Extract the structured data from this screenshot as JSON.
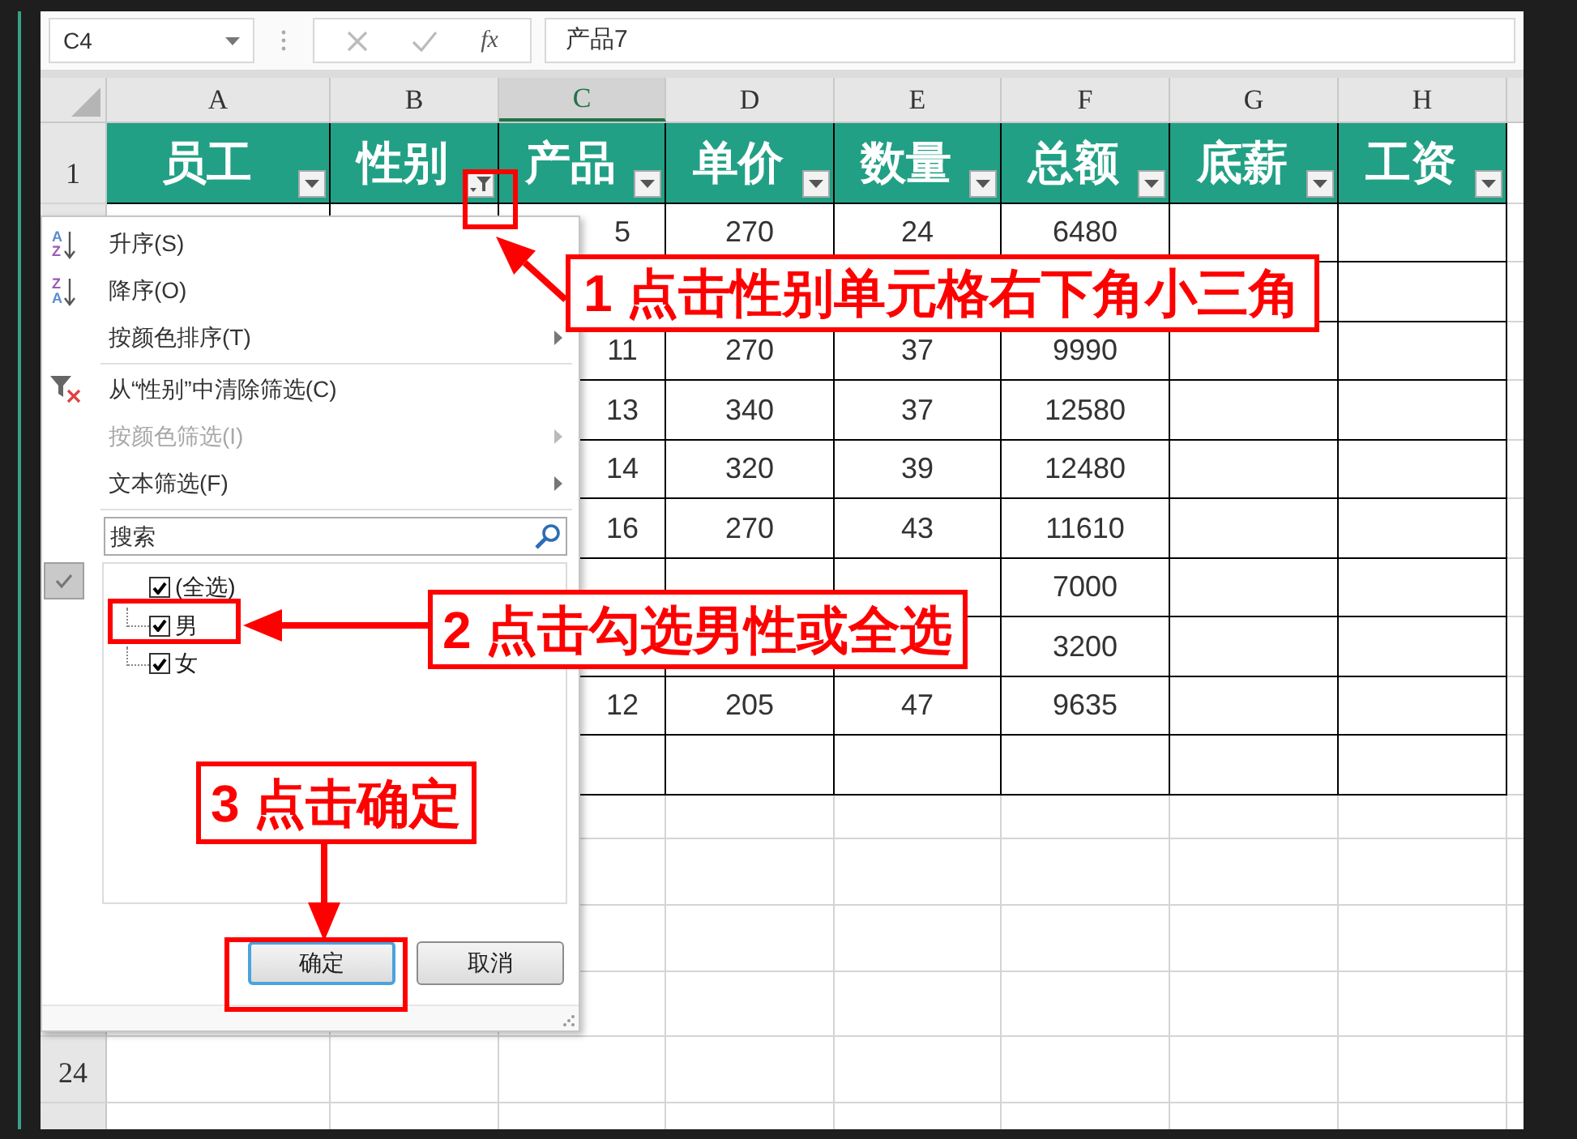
{
  "name_box": {
    "value": "C4"
  },
  "formula_bar": {
    "function_label": "fx",
    "formula": "产品7"
  },
  "column_headers": [
    {
      "label": "A",
      "selected": false
    },
    {
      "label": "B",
      "selected": false
    },
    {
      "label": "C",
      "selected": true
    },
    {
      "label": "D",
      "selected": false
    },
    {
      "label": "E",
      "selected": false
    },
    {
      "label": "F",
      "selected": false
    },
    {
      "label": "G",
      "selected": false
    },
    {
      "label": "H",
      "selected": false
    }
  ],
  "header_row": {
    "row_number": "1",
    "cells": [
      {
        "text": "员工",
        "filtered": false
      },
      {
        "text": "性别",
        "filtered": true
      },
      {
        "text": "产品",
        "filtered": false
      },
      {
        "text": "单价",
        "filtered": false
      },
      {
        "text": "数量",
        "filtered": false
      },
      {
        "text": "总额",
        "filtered": false
      },
      {
        "text": "底薪",
        "filtered": false
      },
      {
        "text": "工资",
        "filtered": false
      }
    ]
  },
  "data_rows": [
    {
      "C": "5",
      "D": "270",
      "E": "24",
      "F": "6480"
    },
    {},
    {
      "C": "11",
      "D": "270",
      "E": "37",
      "F": "9990"
    },
    {
      "C": "13",
      "D": "340",
      "E": "37",
      "F": "12580"
    },
    {
      "C": "14",
      "D": "320",
      "E": "39",
      "F": "12480"
    },
    {
      "C": "16",
      "D": "270",
      "E": "43",
      "F": "11610"
    },
    {
      "F": "7000"
    },
    {
      "F": "3200"
    },
    {
      "C": "12",
      "D": "205",
      "E": "47",
      "F": "9635"
    },
    {}
  ],
  "bottom_row_number": "24",
  "filter_menu": {
    "items": [
      {
        "kind": "sort_ascending",
        "icon_letters": [
          "A",
          "Z"
        ],
        "label": "升序(S)",
        "disabled": false
      },
      {
        "kind": "sort_descending",
        "icon_letters": [
          "Z",
          "A"
        ],
        "label": "降序(O)",
        "disabled": false
      },
      {
        "kind": "submenu",
        "label": "按颜色排序(T)",
        "disabled": false
      },
      {
        "kind": "clear",
        "label": "从“性别”中清除筛选(C)",
        "disabled": false
      },
      {
        "kind": "submenu",
        "label": "按颜色筛选(I)",
        "disabled": true
      },
      {
        "kind": "submenu",
        "label": "文本筛选(F)",
        "disabled": false
      }
    ],
    "search": {
      "placeholder": "搜索"
    },
    "values": [
      {
        "label": "(全选)",
        "checked": true
      },
      {
        "label": "男",
        "checked": true
      },
      {
        "label": "女",
        "checked": true
      }
    ],
    "buttons": [
      {
        "label": "确定",
        "focused": true
      },
      {
        "label": "取消",
        "focused": false
      }
    ]
  },
  "annotations": [
    {
      "text": "1 点击性别单元格右下角小三角"
    },
    {
      "text": "2 点击勾选男性或全选"
    },
    {
      "text": "3 点击确定"
    }
  ]
}
